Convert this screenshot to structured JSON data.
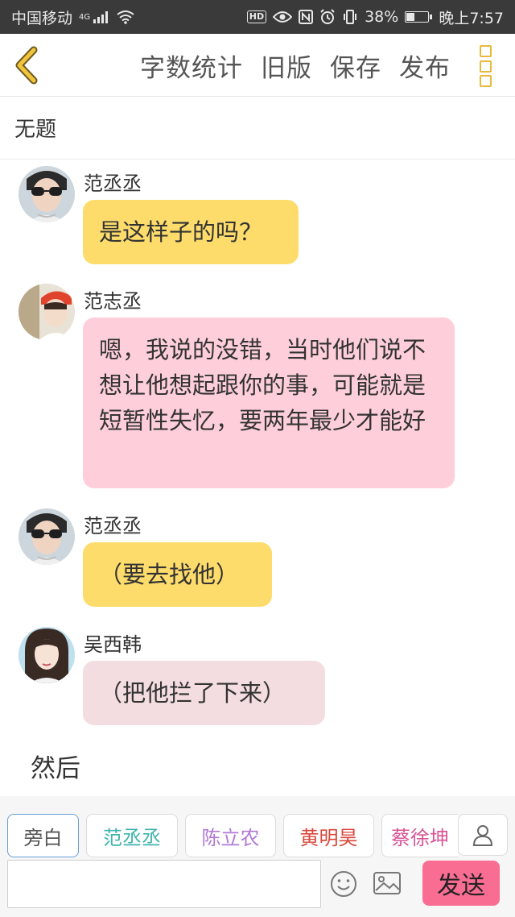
{
  "status_bar": {
    "carrier": "中国移动",
    "network": "4G",
    "hd": "HD",
    "battery_text": "38%",
    "battery_level": 0.38,
    "time": "晚上7:57"
  },
  "toolbar": {
    "actions": [
      "字数统计",
      "旧版",
      "保存",
      "发布"
    ]
  },
  "title": "无题",
  "messages": [
    {
      "sender": "范丞丞",
      "text": "是这样子的吗？"
    },
    {
      "sender": "范志丞",
      "text": "嗯，我说的没错，当时他们说不想让他想起跟你的事，可能就是短暂性失忆，要两年最少才能好"
    },
    {
      "sender": "范丞丞",
      "text": "（要去找他）"
    },
    {
      "sender": "吴西韩",
      "text": "（把他拦了下来）"
    }
  ],
  "narration": "然后",
  "characters": [
    "旁白",
    "范丞丞",
    "陈立农",
    "黄明昊",
    "蔡徐坤"
  ],
  "colors": {
    "chip_text": [
      "#555555",
      "#3fb4ad",
      "#b079d4",
      "#d9473b",
      "#d85496"
    ],
    "accent": "#e8b93a",
    "send": "#fa6d93"
  },
  "input": {
    "value": "",
    "placeholder": ""
  },
  "send_label": "发送"
}
